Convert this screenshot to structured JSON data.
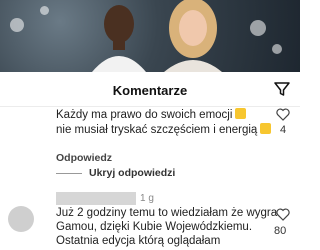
{
  "sheet": {
    "title": "Komentarze"
  },
  "comments": [
    {
      "lines": [
        "Każdy ma prawo do swoich emocji",
        "nie musiał tryskać szczęściem i energią"
      ],
      "likes": "4",
      "reply_label": "Odpowiedz",
      "hide_replies_label": "Ukryj odpowiedzi"
    },
    {
      "timestamp": "1 g",
      "lines": [
        "Już 2 godziny temu to wiedziałam że wygra",
        "Gamou, dzięki Kubie Wojewódzkiemu.",
        "Ostatnia edycja którą oglądałam"
      ],
      "likes": "80"
    }
  ],
  "colors": {
    "emoji": "#f7c62f"
  },
  "icons": [
    "filter-icon",
    "heart-icon",
    "avatar"
  ]
}
